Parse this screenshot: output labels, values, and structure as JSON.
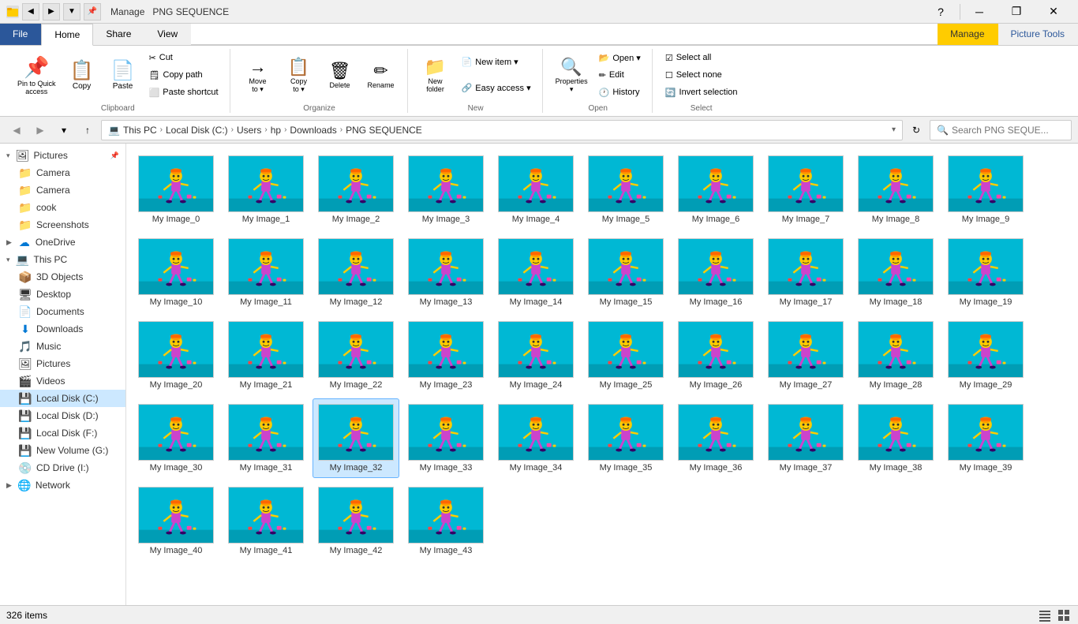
{
  "titleBar": {
    "manageLabel": "Manage",
    "title": "PNG SEQUENCE",
    "minBtn": "─",
    "maxBtn": "❐",
    "closeBtn": "✕",
    "helpBtn": "?"
  },
  "ribbonTabs": {
    "file": "File",
    "home": "Home",
    "share": "Share",
    "view": "View",
    "picTools": "Picture Tools",
    "manage": "Manage"
  },
  "ribbon": {
    "groups": [
      {
        "label": "Clipboard",
        "items": [
          {
            "type": "large",
            "icon": "📌",
            "label": "Pin to Quick\naccess",
            "name": "pin-quick-access"
          },
          {
            "type": "large",
            "icon": "📋",
            "label": "Copy",
            "name": "copy-btn"
          },
          {
            "type": "large",
            "icon": "✂️",
            "label": "Paste",
            "name": "paste-btn"
          },
          {
            "type": "small-col",
            "items": [
              {
                "icon": "✂",
                "label": "Cut",
                "name": "cut-btn"
              },
              {
                "icon": "🗒",
                "label": "Copy path",
                "name": "copy-path-btn"
              },
              {
                "icon": "⬜",
                "label": "Paste shortcut",
                "name": "paste-shortcut-btn"
              }
            ]
          }
        ]
      },
      {
        "label": "Organize",
        "items": [
          {
            "type": "large",
            "icon": "→",
            "label": "Move\nto▾",
            "name": "move-to-btn"
          },
          {
            "type": "large",
            "icon": "📋",
            "label": "Copy\nto▾",
            "name": "copy-to-btn"
          },
          {
            "type": "large",
            "icon": "🗑",
            "label": "Delete",
            "name": "delete-btn"
          },
          {
            "type": "large",
            "icon": "✏",
            "label": "Rename",
            "name": "rename-btn"
          }
        ]
      },
      {
        "label": "New",
        "items": [
          {
            "type": "large-split",
            "icon": "📁",
            "label": "New\nfolder",
            "name": "new-folder-btn"
          },
          {
            "type": "large-split",
            "icon": "📄",
            "label": "New item▾",
            "name": "new-item-btn"
          },
          {
            "type": "small",
            "label": "Easy access▾",
            "name": "easy-access-btn"
          }
        ]
      },
      {
        "label": "Open",
        "items": [
          {
            "type": "large-split",
            "icon": "👁",
            "label": "Properties▾",
            "name": "properties-btn"
          },
          {
            "type": "small-col",
            "items": [
              {
                "icon": "",
                "label": "Open▾",
                "name": "open-btn"
              },
              {
                "icon": "",
                "label": "Edit",
                "name": "edit-btn"
              },
              {
                "icon": "",
                "label": "History",
                "name": "history-btn"
              }
            ]
          }
        ]
      },
      {
        "label": "Select",
        "items": [
          {
            "type": "small",
            "label": "Select all",
            "name": "select-all-btn"
          },
          {
            "type": "small",
            "label": "Select none",
            "name": "select-none-btn"
          },
          {
            "type": "small",
            "label": "Invert selection",
            "name": "invert-selection-btn"
          }
        ]
      }
    ]
  },
  "addressBar": {
    "path": [
      "This PC",
      "Local Disk (C:)",
      "Users",
      "hp",
      "Downloads",
      "PNG SEQUENCE"
    ],
    "searchPlaceholder": "Search PNG SEQUE...",
    "upIcon": "↑",
    "backIcon": "←",
    "forwardIcon": "→",
    "refreshIcon": "↻"
  },
  "sidebar": {
    "items": [
      {
        "label": "Pictures",
        "icon": "🖼",
        "expanded": true,
        "level": 0,
        "name": "sidebar-pictures"
      },
      {
        "label": "Camera",
        "icon": "📁",
        "level": 1,
        "name": "sidebar-camera1"
      },
      {
        "label": "Camera",
        "icon": "📁",
        "level": 1,
        "name": "sidebar-camera2"
      },
      {
        "label": "cook",
        "icon": "📁",
        "level": 1,
        "name": "sidebar-cook"
      },
      {
        "label": "Screenshots",
        "icon": "📁",
        "level": 1,
        "name": "sidebar-screenshots"
      },
      {
        "label": "OneDrive",
        "icon": "☁",
        "level": 0,
        "name": "sidebar-onedrive"
      },
      {
        "label": "This PC",
        "icon": "💻",
        "level": 0,
        "expanded": true,
        "name": "sidebar-thispc"
      },
      {
        "label": "3D Objects",
        "icon": "📦",
        "level": 1,
        "name": "sidebar-3dobjects"
      },
      {
        "label": "Desktop",
        "icon": "🖥",
        "level": 1,
        "name": "sidebar-desktop"
      },
      {
        "label": "Documents",
        "icon": "📄",
        "level": 1,
        "name": "sidebar-documents"
      },
      {
        "label": "Downloads",
        "icon": "⬇",
        "level": 1,
        "name": "sidebar-downloads"
      },
      {
        "label": "Music",
        "icon": "🎵",
        "level": 1,
        "name": "sidebar-music"
      },
      {
        "label": "Pictures",
        "icon": "🖼",
        "level": 1,
        "name": "sidebar-pictures2"
      },
      {
        "label": "Videos",
        "icon": "🎬",
        "level": 1,
        "name": "sidebar-videos"
      },
      {
        "label": "Local Disk (C:)",
        "icon": "💾",
        "level": 1,
        "selected": true,
        "name": "sidebar-localc"
      },
      {
        "label": "Local Disk (D:)",
        "icon": "💾",
        "level": 1,
        "name": "sidebar-locald"
      },
      {
        "label": "Local Disk (F:)",
        "icon": "💾",
        "level": 1,
        "name": "sidebar-localf"
      },
      {
        "label": "New Volume (G:)",
        "icon": "💾",
        "level": 1,
        "name": "sidebar-newvolg"
      },
      {
        "label": "CD Drive (I:)",
        "icon": "💿",
        "level": 1,
        "name": "sidebar-cdi"
      },
      {
        "label": "Network",
        "icon": "🌐",
        "level": 0,
        "name": "sidebar-network"
      }
    ]
  },
  "files": {
    "count": "326 items",
    "items": [
      "My Image_0",
      "My Image_1",
      "My Image_2",
      "My Image_3",
      "My Image_4",
      "My Image_5",
      "My Image_6",
      "My Image_7",
      "My Image_8",
      "My Image_9",
      "My Image_10",
      "My Image_11",
      "My Image_12",
      "My Image_13",
      "My Image_14",
      "My Image_15",
      "My Image_16",
      "My Image_17",
      "My Image_18",
      "My Image_19",
      "My Image_20",
      "My Image_21",
      "My Image_22",
      "My Image_23",
      "My Image_24",
      "My Image_25",
      "My Image_26",
      "My Image_27",
      "My Image_28",
      "My Image_29",
      "My Image_30",
      "My Image_31",
      "My Image_32",
      "My Image_33",
      "My Image_34",
      "My Image_35",
      "My Image_36",
      "My Image_37",
      "My Image_38",
      "My Image_39",
      "My Image_40",
      "My Image_41",
      "My Image_42",
      "My Image_43"
    ]
  },
  "statusBar": {
    "itemCount": "326 items"
  }
}
